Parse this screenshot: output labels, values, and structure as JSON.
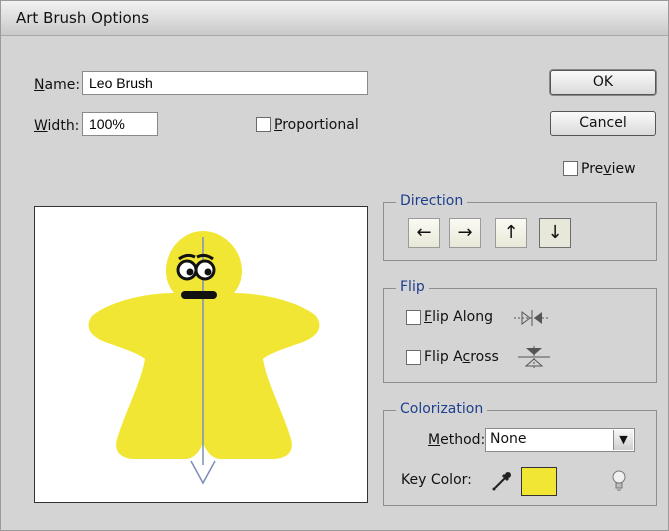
{
  "window": {
    "title": "Art Brush Options"
  },
  "name_field": {
    "label": "Name:",
    "value": "Leo Brush"
  },
  "width_field": {
    "label": "Width:",
    "value": "100%"
  },
  "proportional": {
    "label": "Proportional",
    "checked": false
  },
  "buttons": {
    "ok": "OK",
    "cancel": "Cancel"
  },
  "preview_checkbox": {
    "label": "Preview",
    "checked": false
  },
  "direction": {
    "title": "Direction",
    "buttons": [
      {
        "glyph": "←",
        "icon": "arrow-left-icon",
        "active": false
      },
      {
        "glyph": "→",
        "icon": "arrow-right-icon",
        "active": false
      },
      {
        "glyph": "↑",
        "icon": "arrow-up-icon",
        "active": false
      },
      {
        "glyph": "↓",
        "icon": "arrow-down-icon",
        "active": true
      }
    ]
  },
  "flip": {
    "title": "Flip",
    "along": {
      "label": "Flip Along",
      "checked": false
    },
    "across": {
      "label": "Flip Across",
      "checked": false
    }
  },
  "colorization": {
    "title": "Colorization",
    "method_label": "Method:",
    "method_value": "None",
    "key_color_label": "Key Color:",
    "key_color": "#f2e634"
  },
  "brush_preview": {
    "fill": "#f2e634",
    "icon": "meeple-figure"
  }
}
